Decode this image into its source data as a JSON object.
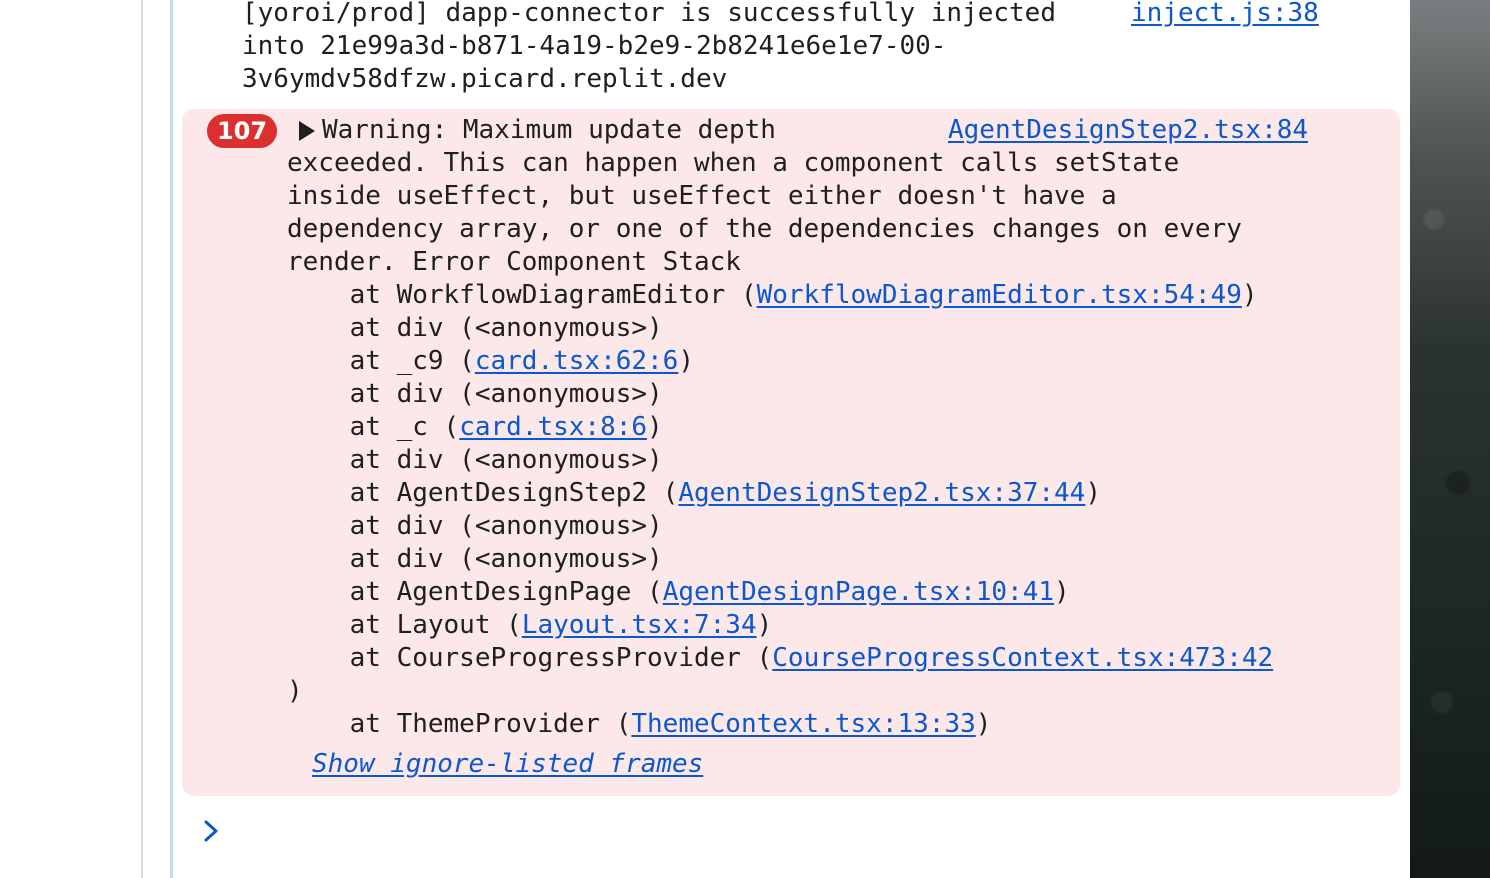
{
  "info_message": {
    "lines": [
      "[yoroi/prod] dapp-connector is successfully injected",
      "into 21e99a3d-b871-4a19-b2e9-2b8241e6e1e7-00-",
      "3v6ymdv58dfzw.picard.replit.dev"
    ],
    "source_link": "inject.js:38"
  },
  "error_message": {
    "count": "107",
    "source_link": "AgentDesignStep2.tsx:84",
    "lines": [
      "Warning: Maximum update depth",
      "exceeded. This can happen when a component calls setState",
      "inside useEffect, but useEffect either doesn't have a",
      "dependency array, or one of the dependencies changes on every",
      "render. Error Component Stack"
    ],
    "stack": [
      {
        "text": "    at WorkflowDiagramEditor (",
        "link": "WorkflowDiagramEditor.tsx:54:49",
        "close": ")"
      },
      {
        "text": "    at div (<anonymous>)",
        "link": "",
        "close": ""
      },
      {
        "text": "    at _c9 (",
        "link": "card.tsx:62:6",
        "close": ")"
      },
      {
        "text": "    at div (<anonymous>)",
        "link": "",
        "close": ""
      },
      {
        "text": "    at _c (",
        "link": "card.tsx:8:6",
        "close": ")"
      },
      {
        "text": "    at div (<anonymous>)",
        "link": "",
        "close": ""
      },
      {
        "text": "    at AgentDesignStep2 (",
        "link": "AgentDesignStep2.tsx:37:44",
        "close": ")"
      },
      {
        "text": "    at div (<anonymous>)",
        "link": "",
        "close": ""
      },
      {
        "text": "    at div (<anonymous>)",
        "link": "",
        "close": ""
      },
      {
        "text": "    at AgentDesignPage (",
        "link": "AgentDesignPage.tsx:10:41",
        "close": ")"
      },
      {
        "text": "    at Layout (",
        "link": "Layout.tsx:7:34",
        "close": ")"
      },
      {
        "text": "    at CourseProgressProvider (",
        "link": "CourseProgressContext.tsx:473:42",
        "close": ""
      },
      {
        "text": ")",
        "link": "",
        "close": ""
      },
      {
        "text": "    at ThemeProvider (",
        "link": "ThemeContext.tsx:13:33",
        "close": ")"
      }
    ],
    "show_frames_label": "Show ignore-listed frames"
  },
  "colors": {
    "error_background": "#fce8e8",
    "badge": "#dc3030",
    "link": "#0b57d0",
    "prompt": "#0b57d0"
  },
  "icons": {
    "expand": "triangle-right-icon",
    "prompt": "chevron-right-icon"
  }
}
